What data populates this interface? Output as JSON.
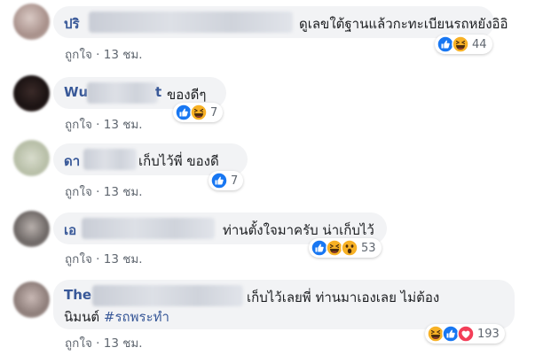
{
  "comments": [
    {
      "name_visible": "ปริ",
      "text": "ดูเลขใต้ฐานแล้วกะทะเบียนรถหยังอิอิ",
      "like_label": "ถูกใจ",
      "time": "13 ชม.",
      "reaction_count": "44"
    },
    {
      "name_visible": "Wu",
      "name_suffix": "t",
      "text": "ของดีๆ",
      "like_label": "ถูกใจ",
      "time": "13 ชม.",
      "reaction_count": "7"
    },
    {
      "name_visible": "ดา",
      "text": "เก็บไว้พี่ ของดี",
      "like_label": "ถูกใจ",
      "time": "13 ชม.",
      "reaction_count": "7"
    },
    {
      "name_visible": "เอ",
      "text": "ท่านตั้งใจมาครับ น่าเก็บไว้",
      "like_label": "ถูกใจ",
      "time": "13 ชม.",
      "reaction_count": "53"
    },
    {
      "name_visible": "The",
      "text_line1": "เก็บไว้เลยพี่ ท่านมาเองเลย ไม่ต้อง",
      "text_line2_plain": "นิมนต์",
      "hashtag": "#รถพระทำ",
      "like_label": "ถูกใจ",
      "time": "13 ชม.",
      "reaction_count": "193"
    }
  ],
  "separator": "·",
  "colors": {
    "name": "#385898",
    "bubble": "#f2f3f5",
    "meta": "#606770",
    "like_blue": "#1877f2",
    "haha_yellow": "#f7b125",
    "love_red": "#f33e58"
  },
  "icons": [
    "like-reaction-icon",
    "haha-reaction-icon",
    "wow-reaction-icon",
    "love-reaction-icon"
  ]
}
